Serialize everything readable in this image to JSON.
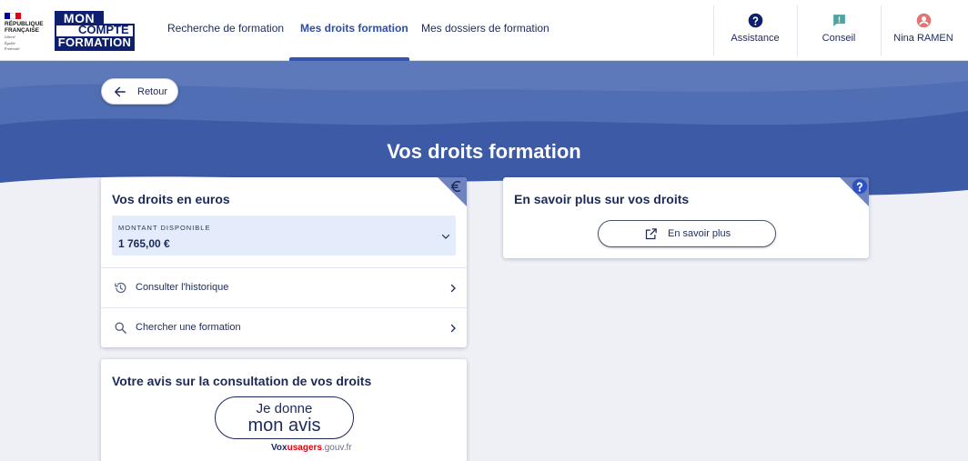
{
  "header": {
    "republique": [
      "RÉPUBLIQUE",
      "FRANÇAISE"
    ],
    "motto": [
      "Liberté",
      "Égalité",
      "Fraternité"
    ],
    "logo": {
      "line1": "MON",
      "line2": "COMPTE",
      "line3": "FORMATION"
    },
    "nav": [
      {
        "label": "Recherche de formation",
        "active": false
      },
      {
        "label": "Mes droits formation",
        "active": true
      },
      {
        "label": "Mes dossiers de formation",
        "active": false
      }
    ],
    "actions": [
      {
        "label": "Assistance",
        "icon": "help-circle-icon"
      },
      {
        "label": "Conseil",
        "icon": "chat-icon"
      },
      {
        "label": "Nina RAMEN",
        "icon": "user-icon"
      }
    ]
  },
  "banner": {
    "back_label": "Retour",
    "title": "Vos droits formation"
  },
  "rights_card": {
    "title": "Vos droits en euros",
    "corner_icon": "euro-icon",
    "amount_label": "MONTANT DISPONIBLE",
    "amount_value": "1 765,00 €",
    "rows": [
      {
        "label": "Consulter l'historique",
        "icon": "history-icon"
      },
      {
        "label": "Chercher une formation",
        "icon": "search-icon"
      }
    ]
  },
  "info_card": {
    "title": "En savoir plus sur vos droits",
    "corner_icon": "question-icon",
    "button_label": "En savoir plus"
  },
  "feedback_card": {
    "title": "Votre avis sur la consultation de vos droits",
    "button_line1": "Je donne",
    "button_line2": "mon avis",
    "vox_part1": "Vox",
    "vox_part2": "usagers",
    "vox_part3": ".gouv.fr"
  },
  "colors": {
    "primary": "#1c2a5a",
    "accent": "#3456b0",
    "banner": "#3f5ca8",
    "help": "#0f1f6f",
    "conseil": "#4ca5a0",
    "user": "#e57373"
  }
}
